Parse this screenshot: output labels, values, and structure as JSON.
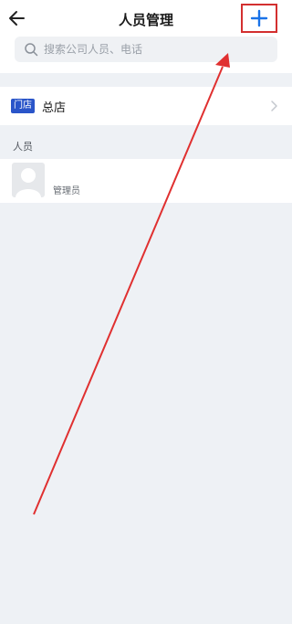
{
  "header": {
    "title": "人员管理",
    "back_icon": "arrow-left-icon",
    "add_icon": "plus-icon",
    "accent_color": "#1a73e8"
  },
  "search": {
    "placeholder": "搜索公司人员、电话",
    "value": ""
  },
  "store": {
    "badge": "门店",
    "name": "总店",
    "badge_color": "#2a55c9"
  },
  "people_section": {
    "label": "人员",
    "items": [
      {
        "role": "管理员",
        "avatar_icon": "avatar-placeholder-icon"
      }
    ]
  },
  "annotation": {
    "highlight_color": "#d32f2f",
    "arrow_color": "#e03030"
  }
}
